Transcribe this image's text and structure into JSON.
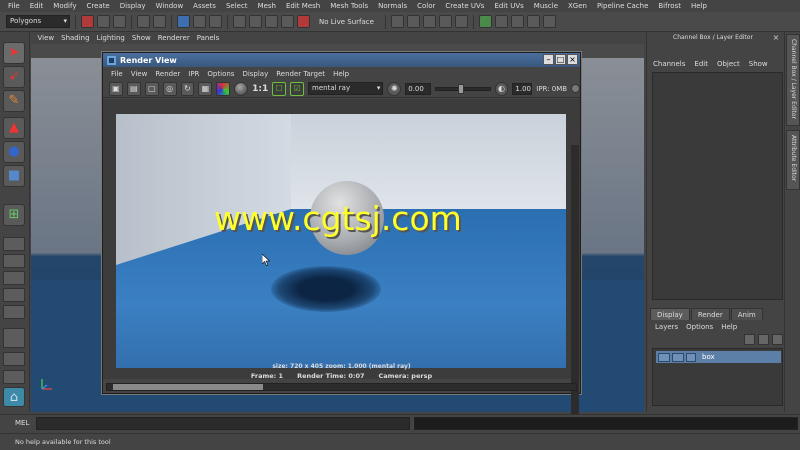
{
  "main_menu": [
    "File",
    "Edit",
    "Modify",
    "Create",
    "Display",
    "Window",
    "Assets",
    "Select",
    "Mesh",
    "Edit Mesh",
    "Mesh Tools",
    "Normals",
    "Color",
    "Create UVs",
    "Edit UVs",
    "Muscle",
    "XGen",
    "Pipeline Cache",
    "Bifrost",
    "Help"
  ],
  "status_line": {
    "mode": "Polygons",
    "live_surface": "No Live Surface"
  },
  "viewport_menu": [
    "View",
    "Shading",
    "Lighting",
    "Show",
    "Renderer",
    "Panels"
  ],
  "render_view": {
    "title": "Render View",
    "menu": [
      "File",
      "View",
      "Render",
      "IPR",
      "Options",
      "Display",
      "Render Target",
      "Help"
    ],
    "ratio_label": "1:1",
    "renderer": "mental ray",
    "exposure": "0.00",
    "gamma": "1.00",
    "ipr_label": "IPR: 0MB",
    "info_line": "size: 720 x 405 zoom: 1.000        (mental ray)",
    "status": {
      "frame": "Frame: 1",
      "render_time": "Render Time: 0:07",
      "camera": "Camera: persp"
    }
  },
  "watermark": "www.cgtsj.com",
  "channel_box": {
    "title": "Channel Box / Layer Editor",
    "menu": [
      "Channels",
      "Edit",
      "Object",
      "Show"
    ]
  },
  "layer_editor": {
    "tabs": [
      "Display",
      "Render",
      "Anim"
    ],
    "menu": [
      "Layers",
      "Options",
      "Help"
    ],
    "layer_name": "box"
  },
  "side_tabs": [
    "Channel Box / Layer Editor",
    "Attribute Editor"
  ],
  "command_line": {
    "label": "MEL"
  },
  "help_line": "No help available for this tool",
  "colors": {
    "ui_bg": "#444444",
    "title_bar": "#4a6f9c",
    "watermark": "#ffff2a",
    "floor_blue": "#2a6fb2"
  }
}
